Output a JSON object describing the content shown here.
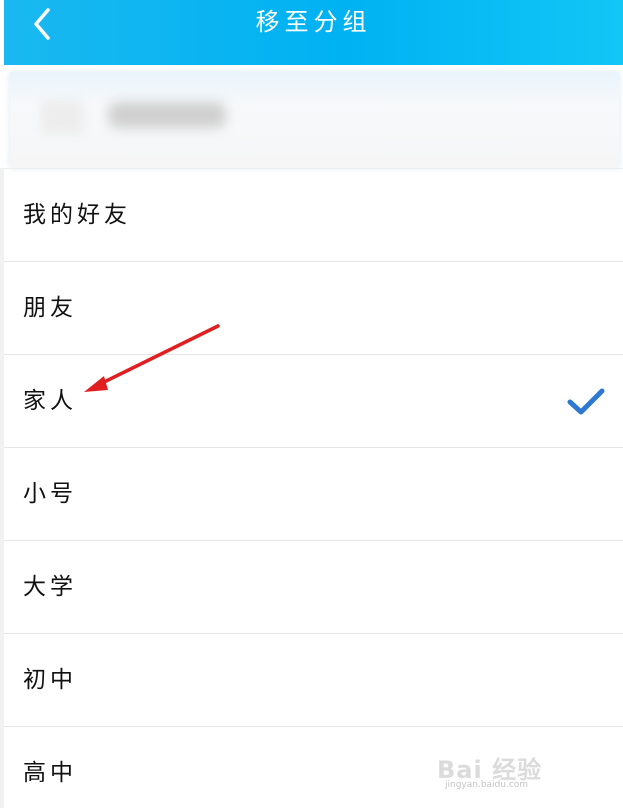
{
  "header": {
    "title": "移至分组",
    "back_icon": "chevron-left-icon",
    "background_color": "#00b2f2"
  },
  "contact": {
    "name": "",
    "blurred": true
  },
  "groups": [
    {
      "label": "我的好友",
      "selected": false
    },
    {
      "label": "朋友",
      "selected": false
    },
    {
      "label": "家人",
      "selected": true
    },
    {
      "label": "小号",
      "selected": false
    },
    {
      "label": "大学",
      "selected": false
    },
    {
      "label": "初中",
      "selected": false
    },
    {
      "label": "高中",
      "selected": false
    }
  ],
  "selection_icon": "checkmark-icon",
  "selection_color": "#2e78d2",
  "annotation": {
    "type": "arrow",
    "points_to": "家人",
    "color": "#e02020"
  },
  "watermark": {
    "text": "Bai 经验",
    "subtext": "jingyan.baidu.com"
  }
}
